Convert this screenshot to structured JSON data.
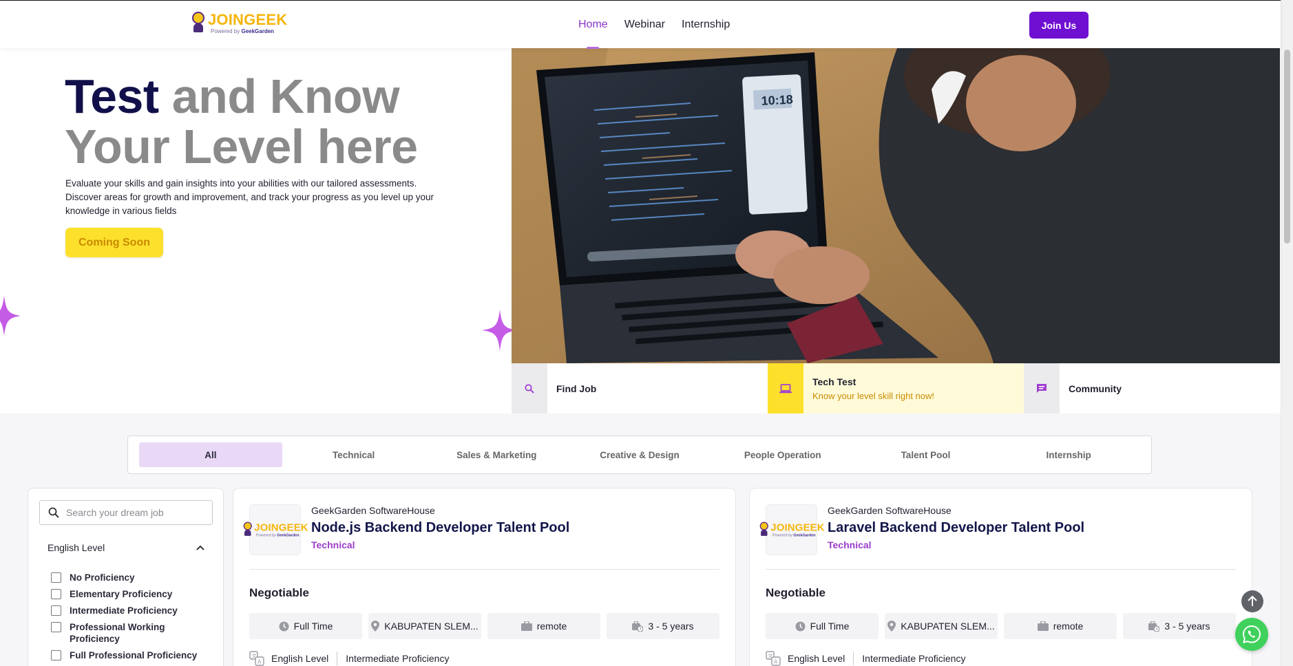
{
  "header": {
    "logo_text": "JOINGEEK",
    "logo_sub_prefix": "Powered by",
    "logo_sub_brand": "GeekGarden",
    "nav": [
      {
        "label": "Home",
        "active": true
      },
      {
        "label": "Webinar",
        "active": false
      },
      {
        "label": "Internship",
        "active": false
      }
    ],
    "join_label": "Join Us"
  },
  "hero": {
    "title_dark": "Test",
    "title_rest_line1": "and Know",
    "title_line2": "Your Level here",
    "description": "Evaluate your skills and gain insights into your abilities with our tailored assessments. Discover areas for growth and improvement, and track your progress as you level up your knowledge in various fields",
    "cta_label": "Coming Soon"
  },
  "quick_links": [
    {
      "title": "Find Job",
      "subtitle": "",
      "icon": "search-icon",
      "active": false
    },
    {
      "title": "Tech Test",
      "subtitle": "Know your level skill right now!",
      "icon": "laptop-icon",
      "active": true
    },
    {
      "title": "Community",
      "subtitle": "",
      "icon": "chat-icon",
      "active": false
    }
  ],
  "tabs": [
    "All",
    "Technical",
    "Sales & Marketing",
    "Creative & Design",
    "People Operation",
    "Talent Pool",
    "Internship"
  ],
  "filter": {
    "search_placeholder": "Search your dream job",
    "section_label": "English Level",
    "options": [
      "No Proficiency",
      "Elementary Proficiency",
      "Intermediate Proficiency",
      "Professional Working Proficiency",
      "Full Professional Proficiency"
    ]
  },
  "jobs": [
    {
      "company": "GeekGarden SoftwareHouse",
      "title": "Node.js Backend Developer Talent Pool",
      "category": "Technical",
      "salary": "Negotiable",
      "type": "Full Time",
      "location": "KABUPATEN SLEM...",
      "mode": "remote",
      "experience": "3 - 5 years",
      "lang_label": "English Level",
      "lang_value": "Intermediate Proficiency"
    },
    {
      "company": "GeekGarden SoftwareHouse",
      "title": "Laravel Backend Developer Talent Pool",
      "category": "Technical",
      "salary": "Negotiable",
      "type": "Full Time",
      "location": "KABUPATEN SLEM...",
      "mode": "remote",
      "experience": "3 - 5 years",
      "lang_label": "English Level",
      "lang_value": "Intermediate Proficiency"
    }
  ],
  "colors": {
    "accent_purple": "#6f0fd1",
    "active_nav": "#8a33c9",
    "cta_yellow": "#fde02c",
    "category_purple": "#9b3dcb",
    "whatsapp_green": "#3fd15c"
  }
}
